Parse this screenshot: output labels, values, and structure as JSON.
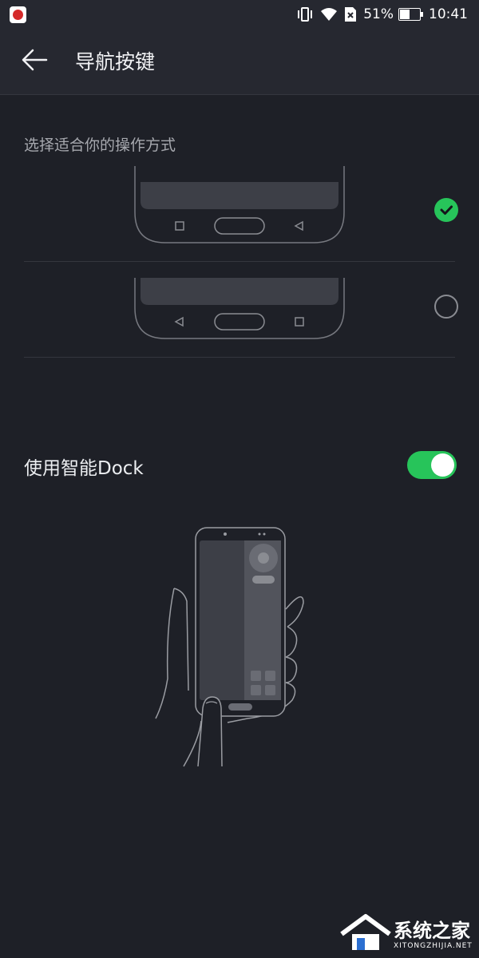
{
  "status_bar": {
    "battery": "51%",
    "time": "10:41",
    "icons": [
      "vibrate-icon",
      "wifi-icon",
      "no-sim-icon",
      "battery-icon"
    ]
  },
  "header": {
    "title": "导航按键",
    "back_icon": "back-arrow-icon"
  },
  "section": {
    "label": "选择适合你的操作方式"
  },
  "options": [
    {
      "id": "layout-1",
      "selected": true
    },
    {
      "id": "layout-2",
      "selected": false
    }
  ],
  "dock": {
    "label": "使用智能Dock",
    "enabled": true
  },
  "watermark": {
    "title": "系统之家",
    "subtitle": "XITONGZHIJIA.NET"
  },
  "colors": {
    "accent": "#27c45a",
    "background": "#1e2027",
    "header": "#262830"
  }
}
